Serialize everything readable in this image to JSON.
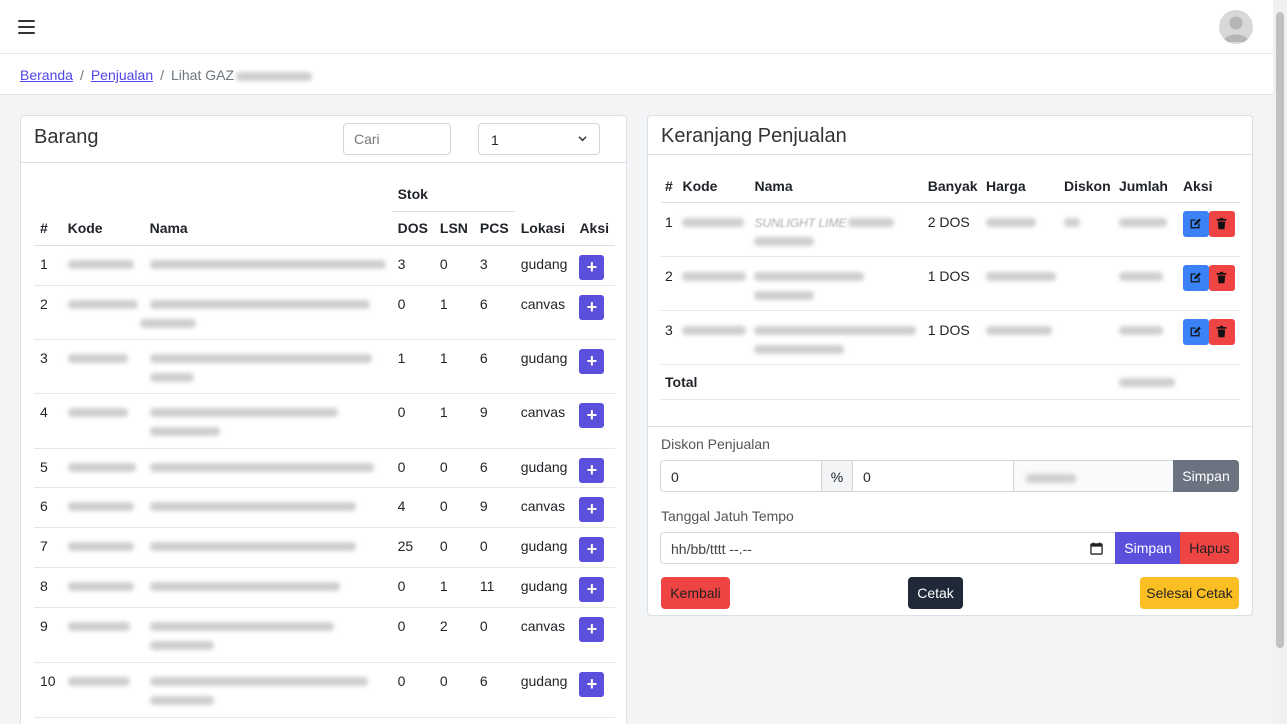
{
  "breadcrumb": {
    "home": "Beranda",
    "section": "Penjualan",
    "current": "Lihat GAZ",
    "sep": "/"
  },
  "barang": {
    "title": "Barang",
    "search_placeholder": "Cari",
    "page": "1",
    "headers": {
      "no": "#",
      "kode": "Kode",
      "nama": "Nama",
      "stok": "Stok",
      "dos": "DOS",
      "lsn": "LSN",
      "pcs": "PCS",
      "lokasi": "Lokasi",
      "aksi": "Aksi"
    },
    "add_symbol": "+",
    "rows": [
      {
        "no": "1",
        "dos": "3",
        "lsn": "0",
        "pcs": "3",
        "lokasi": "gudang"
      },
      {
        "no": "2",
        "dos": "0",
        "lsn": "1",
        "pcs": "6",
        "lokasi": "canvas"
      },
      {
        "no": "3",
        "dos": "1",
        "lsn": "1",
        "pcs": "6",
        "lokasi": "gudang"
      },
      {
        "no": "4",
        "dos": "0",
        "lsn": "1",
        "pcs": "9",
        "lokasi": "canvas"
      },
      {
        "no": "5",
        "dos": "0",
        "lsn": "0",
        "pcs": "6",
        "lokasi": "gudang"
      },
      {
        "no": "6",
        "dos": "4",
        "lsn": "0",
        "pcs": "9",
        "lokasi": "canvas"
      },
      {
        "no": "7",
        "dos": "25",
        "lsn": "0",
        "pcs": "0",
        "lokasi": "gudang"
      },
      {
        "no": "8",
        "dos": "0",
        "lsn": "1",
        "pcs": "11",
        "lokasi": "gudang"
      },
      {
        "no": "9",
        "dos": "0",
        "lsn": "2",
        "pcs": "0",
        "lokasi": "canvas"
      },
      {
        "no": "10",
        "dos": "0",
        "lsn": "0",
        "pcs": "6",
        "lokasi": "gudang"
      }
    ]
  },
  "keranjang": {
    "title": "Keranjang Penjualan",
    "headers": {
      "no": "#",
      "kode": "Kode",
      "nama": "Nama",
      "banyak": "Banyak",
      "harga": "Harga",
      "diskon": "Diskon",
      "jumlah": "Jumlah",
      "aksi": "Aksi"
    },
    "rows": [
      {
        "no": "1",
        "nama": "SUNLIGHT LIME",
        "banyak": "2 DOS"
      },
      {
        "no": "2",
        "nama": "",
        "banyak": "1 DOS"
      },
      {
        "no": "3",
        "nama": "",
        "banyak": "1 DOS"
      }
    ],
    "total_label": "Total",
    "diskon_label": "Diskon Penjualan",
    "diskon_percent": "0",
    "percent_symbol": "%",
    "diskon_amount": "0",
    "simpan_label": "Simpan",
    "tempo_label": "Tanggal Jatuh Tempo",
    "tempo_placeholder": "hh/bb/tttt --.--",
    "hapus_label": "Hapus",
    "kembali_label": "Kembali",
    "cetak_label": "Cetak",
    "selesai_cetak_label": "Selesai Cetak"
  },
  "colors": {
    "primary": "#5b50dc",
    "info": "#3b82f6",
    "danger": "#ef4444",
    "dark": "#1f2937",
    "warning": "#fbbf24",
    "secondary": "#6b7280"
  }
}
